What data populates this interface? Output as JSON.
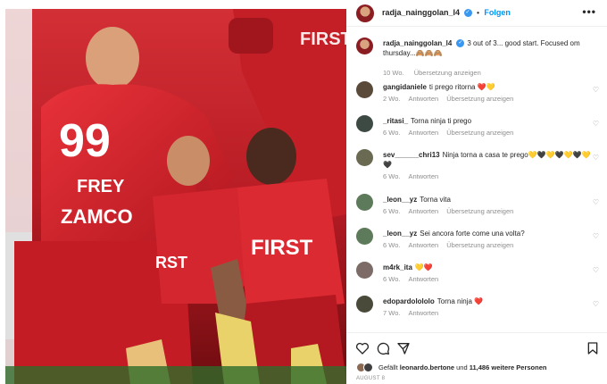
{
  "post": {
    "username": "radja_nainggolan_l4",
    "follow_label": "Folgen",
    "more_label": "•••",
    "caption": "3 out of 3... good start. Focused om thursday...🙈🙈🙈",
    "caption_time": "10 Wo.",
    "caption_translate": "Übersetzung anzeigen"
  },
  "photo": {
    "jersey_number": "99",
    "jersey_name": "FREY",
    "sponsor_1": "ZAMCO",
    "sponsor_2": "FIRST",
    "sponsor_3": "FIRST",
    "sponsor_4": "RST"
  },
  "labels": {
    "reply": "Antworten",
    "translate": "Übersetzung anzeigen"
  },
  "comments": [
    {
      "user": "gangidaniele",
      "text": "ti prego ritorna ❤️💛",
      "time": "2 Wo."
    },
    {
      "user": "_ritasi_",
      "text": "Torna ninja ti prego",
      "time": "6 Wo."
    },
    {
      "user": "sev______chri13",
      "text": "Ninja torna a casa te prego💛🖤💛🖤💛🖤💛🖤",
      "time": "6 Wo."
    },
    {
      "user": "_leon__yz",
      "text": "Torna vita",
      "time": "6 Wo."
    },
    {
      "user": "_leon__yz",
      "text": "Sei ancora forte come una volta?",
      "time": "6 Wo."
    },
    {
      "user": "m4rk_ita",
      "text": "💛❤️",
      "time": "6 Wo."
    },
    {
      "user": "edopardolololo",
      "text": "Torna ninja ❤️",
      "time": "7 Wo."
    }
  ],
  "likes": {
    "prefix": "Gefällt",
    "user": "leonardo.bertone",
    "connector": "und",
    "count": "11,486 weitere Personen"
  },
  "date": "AUGUST 8",
  "colors": {
    "accent_blue": "#0095f6",
    "jersey_red": "#c8262e",
    "meta_gray": "#8e8e8e"
  },
  "icons": [
    "verified-badge-icon",
    "heart-icon",
    "comment-icon",
    "share-icon",
    "bookmark-icon",
    "more-icon"
  ]
}
